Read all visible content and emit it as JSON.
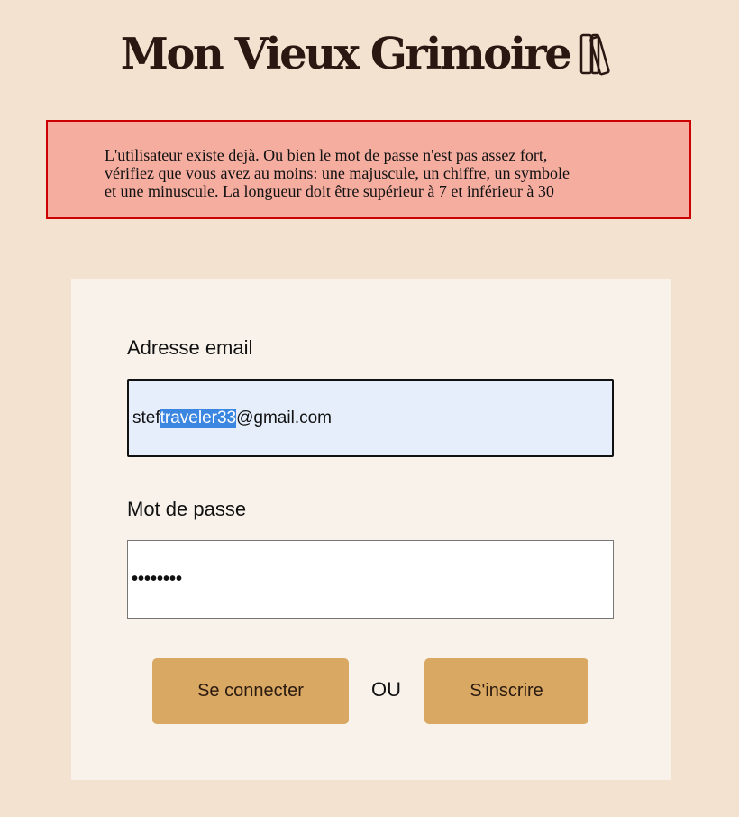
{
  "header": {
    "title": "Mon Vieux Grimoire",
    "logo_icon": "books-icon"
  },
  "error": {
    "line1": "L'utilisateur existe dejà. Ou bien le mot de passe n'est pas assez fort,",
    "line2": "vérifiez que vous avez au moins: une majuscule, un chiffre, un symbole",
    "line3": "et une minuscule. La longueur doit être supérieur à 7 et inférieur à 30",
    "background": "#f5ada0",
    "border": "#cc0000"
  },
  "form": {
    "email_label": "Adresse email",
    "email_value_before": "stef",
    "email_value_selected": "traveler33",
    "email_value_after": "@gmail.com",
    "password_label": "Mot de passe",
    "password_value": "••••••••",
    "login_button": "Se connecter",
    "or_text": "OU",
    "signup_button": "S'inscrire"
  },
  "colors": {
    "page_background": "#f2e2cf",
    "card_background": "#f8f2eb",
    "button": "#d9a862",
    "email_field_background": "#e6eefb",
    "selection": "#3b86e0"
  }
}
